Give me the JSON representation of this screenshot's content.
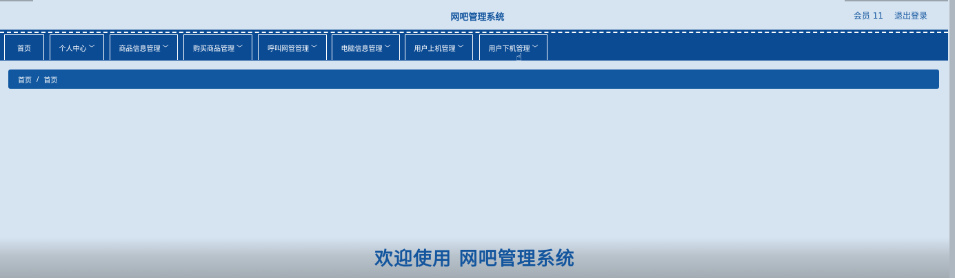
{
  "header": {
    "title": "网吧管理系统",
    "user_label": "会员 11",
    "logout_label": "退出登录"
  },
  "nav": {
    "items": [
      {
        "label": "首页",
        "has_dropdown": false
      },
      {
        "label": "个人中心",
        "has_dropdown": true
      },
      {
        "label": "商品信息管理",
        "has_dropdown": true
      },
      {
        "label": "购买商品管理",
        "has_dropdown": true
      },
      {
        "label": "呼叫网管管理",
        "has_dropdown": true
      },
      {
        "label": "电脑信息管理",
        "has_dropdown": true
      },
      {
        "label": "用户上机管理",
        "has_dropdown": true
      },
      {
        "label": "用户下机管理",
        "has_dropdown": true
      }
    ],
    "caret": "﹀"
  },
  "breadcrumb": {
    "items": [
      "首页",
      "首页"
    ],
    "separator": "/"
  },
  "footer": {
    "welcome": "欢迎使用 网吧管理系统"
  },
  "colors": {
    "background": "#d6e4f2",
    "nav_bg": "#0b4b94",
    "breadcrumb_bg": "#1158a0",
    "title_text": "#14569e"
  },
  "icons": {
    "caret": "chevron-down-icon",
    "cursor": "hand-pointer-icon"
  }
}
